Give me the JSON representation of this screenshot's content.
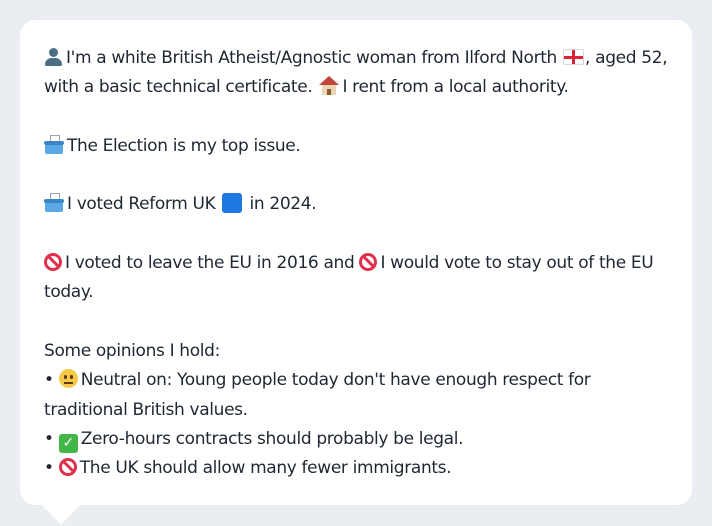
{
  "bubble": {
    "intro": {
      "text_1": "I'm a white British Atheist/Agnostic woman from Ilford North",
      "text_2": ", aged 52, with a basic technical certificate.",
      "text_3": "I rent from a local authority."
    },
    "top_issue": "The Election is my top issue.",
    "vote_2024": {
      "before": "I voted Reform UK",
      "after": "in 2024.",
      "party_color": "#1e78e0"
    },
    "eu": {
      "part_1": "I voted to leave the EU in 2016 and",
      "part_2": "I would vote to stay out of the EU today."
    },
    "opinions": {
      "heading": "Some opinions I hold:",
      "bullet": "•",
      "items": [
        {
          "icon": "neutral-face-icon",
          "text": "Neutral on: Young people today don't have enough respect for traditional British values."
        },
        {
          "icon": "check-mark-icon",
          "text": "Zero-hours contracts should probably be legal."
        },
        {
          "icon": "prohibited-icon",
          "text": "The UK should allow many fewer immigrants."
        }
      ]
    }
  },
  "icons": {
    "person": "person-silhouette-icon",
    "flag": "england-flag-icon",
    "house": "house-icon",
    "ballot": "ballot-box-icon",
    "party_square": "blue-square-icon",
    "prohibited": "prohibited-icon",
    "check_glyph": "✓"
  }
}
